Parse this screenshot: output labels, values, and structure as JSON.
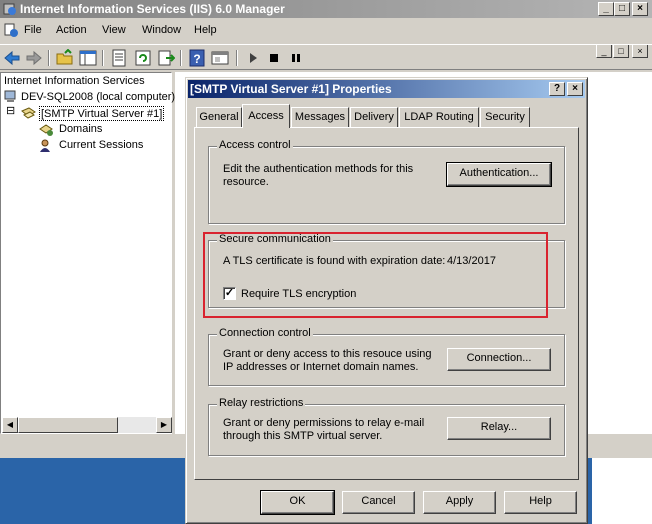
{
  "window": {
    "title": "Internet Information Services (IIS) 6.0 Manager",
    "controls": [
      "_",
      "□",
      "×"
    ]
  },
  "menu": [
    "File",
    "Action",
    "View",
    "Window",
    "Help"
  ],
  "mdi_controls": [
    "_",
    "□",
    "×"
  ],
  "tree": {
    "root": "Internet Information Services",
    "computer": "DEV-SQL2008 (local computer)",
    "server": "[SMTP Virtual Server #1]",
    "children": [
      "Domains",
      "Current Sessions"
    ],
    "expander": "⊟"
  },
  "dialog": {
    "title": "[SMTP Virtual Server #1] Properties",
    "controls": [
      "?",
      "×"
    ],
    "tabs": [
      "General",
      "Access",
      "Messages",
      "Delivery",
      "LDAP Routing",
      "Security"
    ],
    "active_tab": "Access",
    "access_control": {
      "legend": "Access control",
      "text": "Edit the authentication methods for this resource.",
      "button": "Authentication..."
    },
    "secure_communication": {
      "legend": "Secure communication",
      "text": "A TLS certificate is found with expiration date:",
      "date": "4/13/2017",
      "checkbox_label": "Require TLS encryption",
      "checked": true,
      "check_mark": "✓"
    },
    "connection_control": {
      "legend": "Connection control",
      "text": "Grant or deny access to this resouce using IP addresses or Internet domain names.",
      "button": "Connection..."
    },
    "relay_restrictions": {
      "legend": "Relay restrictions",
      "text": "Grant or deny permissions to relay e-mail through this SMTP virtual server.",
      "button": "Relay..."
    },
    "buttons": [
      "OK",
      "Cancel",
      "Apply",
      "Help"
    ]
  },
  "colors": {
    "highlight": "#d9232f",
    "dialog_title_start": "#0a246a",
    "inactive_title": "#808080"
  }
}
